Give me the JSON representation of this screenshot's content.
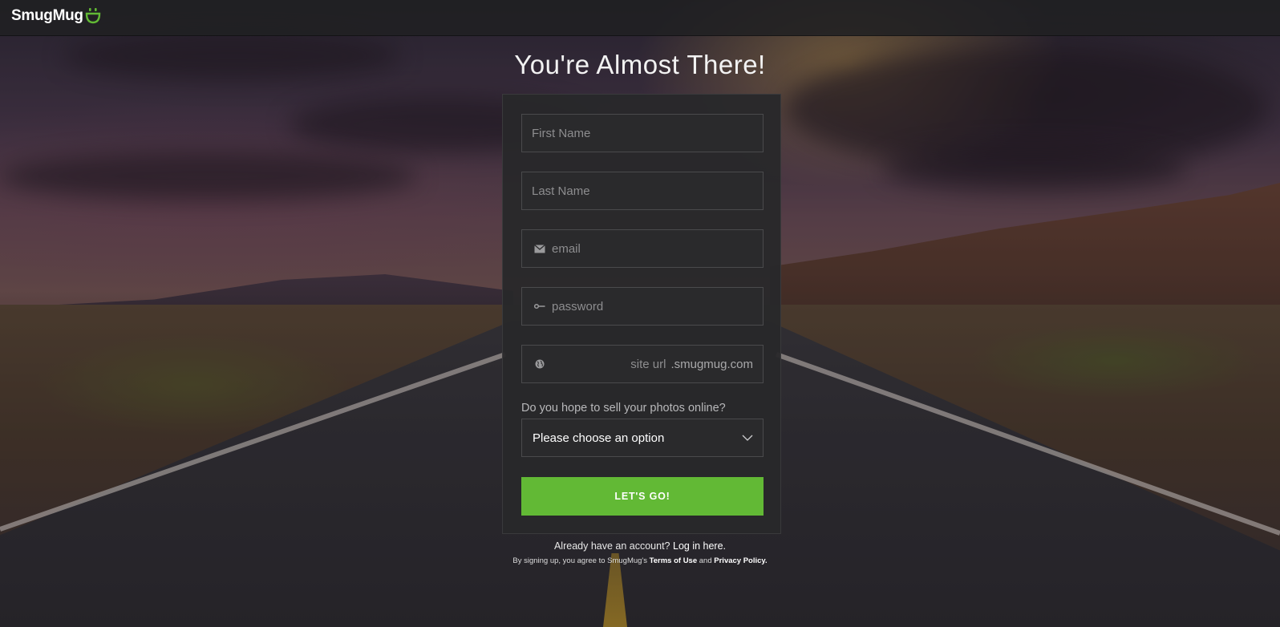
{
  "brand": {
    "name": "SmugMug",
    "accent": "#62b935"
  },
  "heading": "You're Almost There!",
  "form": {
    "first_name": {
      "placeholder": "First Name",
      "value": ""
    },
    "last_name": {
      "placeholder": "Last Name",
      "value": ""
    },
    "email": {
      "placeholder": "email",
      "value": "",
      "icon": "envelope-icon"
    },
    "password": {
      "placeholder": "password",
      "value": "",
      "icon": "key-icon"
    },
    "site_url": {
      "placeholder": "site url",
      "suffix": ".smugmug.com",
      "icon": "globe-icon"
    },
    "sell_question": "Do you hope to sell your photos online?",
    "sell_select": {
      "selected": "Please choose an option"
    },
    "submit_label": "LET'S GO!"
  },
  "footer": {
    "have_account": "Already have an account?",
    "login_link": "Log in here.",
    "terms_prefix": "By signing up, you agree to SmugMug's",
    "terms_link": "Terms of Use",
    "and": "and",
    "privacy_link": "Privacy Policy."
  }
}
